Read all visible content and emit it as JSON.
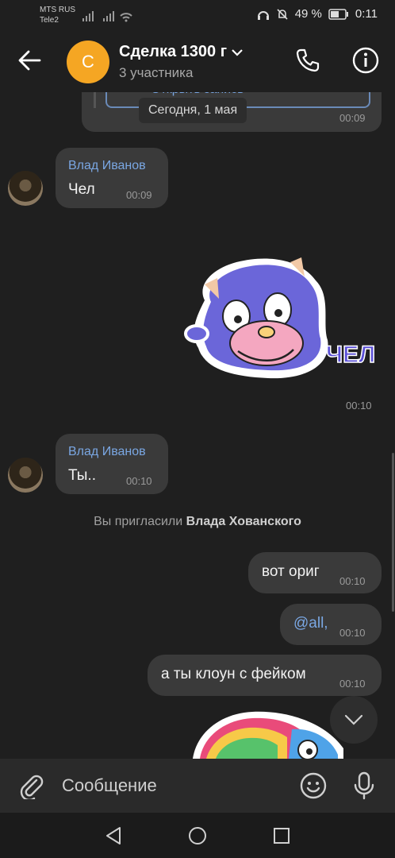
{
  "status_bar": {
    "carrier1": "MTS RUS",
    "carrier2": "Tele2",
    "battery": "49 %",
    "time": "0:11"
  },
  "header": {
    "avatar_letter": "С",
    "title": "Сделка 1300 г",
    "subtitle": "3 участника"
  },
  "previous_message": {
    "button_label": "Открыть запись",
    "time": "00:09"
  },
  "date_separator": "Сегодня, 1 мая",
  "messages": [
    {
      "sender": "Влад Иванов",
      "text": "Чел",
      "time": "00:09"
    },
    {
      "sticker_caption": "ЧЕЛ",
      "time": "00:10"
    },
    {
      "sender": "Влад Иванов",
      "text": "Ты..",
      "time": "00:10"
    }
  ],
  "system_note": {
    "prefix": "Вы пригласили ",
    "name": "Влада Хованского"
  },
  "outgoing": [
    {
      "text": "вот ориг",
      "time": "00:10"
    },
    {
      "text": "@all,",
      "time": "00:10"
    },
    {
      "text": "а ты клоун с фейком",
      "time": "00:10"
    }
  ],
  "composer": {
    "placeholder": "Сообщение"
  },
  "colors": {
    "accent": "#7aa7e3",
    "avatar": "#f5a623",
    "bubble": "#3a3a3a",
    "background": "#1f1f1f"
  },
  "icons": [
    "back-arrow-icon",
    "phone-icon",
    "info-icon",
    "chevron-down-icon",
    "paperclip-icon",
    "emoji-icon",
    "microphone-icon",
    "nav-back-icon",
    "nav-home-icon",
    "nav-recent-icon"
  ]
}
